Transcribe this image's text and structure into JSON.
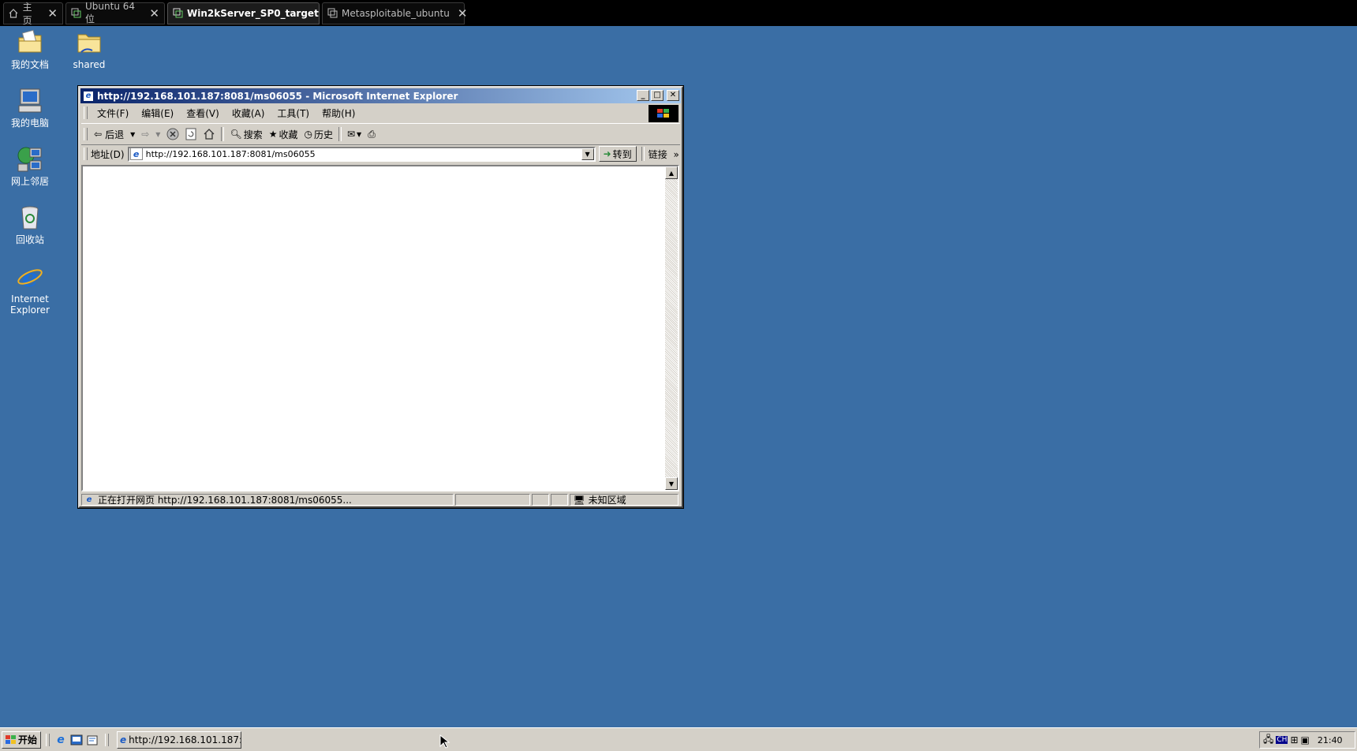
{
  "vm_tabs": [
    {
      "label": "主页",
      "icon": "home-icon",
      "active": false
    },
    {
      "label": "Ubuntu 64 位",
      "icon": "vm-icon",
      "active": false
    },
    {
      "label": "Win2kServer_SP0_target",
      "icon": "vm-icon",
      "active": true
    },
    {
      "label": "Metasploitable_ubuntu",
      "icon": "vm-icon",
      "active": false
    }
  ],
  "desktop_icons": [
    {
      "label": "我的文档",
      "icon": "my-documents-icon"
    },
    {
      "label": "shared",
      "icon": "folder-icon"
    },
    {
      "label": "我的电脑",
      "icon": "my-computer-icon"
    },
    {
      "label": "网上邻居",
      "icon": "network-places-icon"
    },
    {
      "label": "回收站",
      "icon": "recycle-bin-icon"
    },
    {
      "label": "Internet Explorer",
      "icon": "internet-explorer-icon"
    }
  ],
  "ie": {
    "title": "http://192.168.101.187:8081/ms06055 - Microsoft Internet Explorer",
    "menu": [
      "文件(F)",
      "编辑(E)",
      "查看(V)",
      "收藏(A)",
      "工具(T)",
      "帮助(H)"
    ],
    "toolbar": {
      "back": "后退",
      "search": "搜索",
      "favorites": "收藏",
      "history": "历史"
    },
    "address_label": "地址(D)",
    "address_value": "http://192.168.101.187:8081/ms06055",
    "go_label": "转到",
    "links_label": "链接",
    "status_text": "正在打开网页 http://192.168.101.187:8081/ms06055...",
    "zone_text": "未知区域"
  },
  "taskbar": {
    "start_label": "开始",
    "task_item": "http://192.168.101.187:...",
    "clock": "21:40",
    "lang": "CH"
  }
}
